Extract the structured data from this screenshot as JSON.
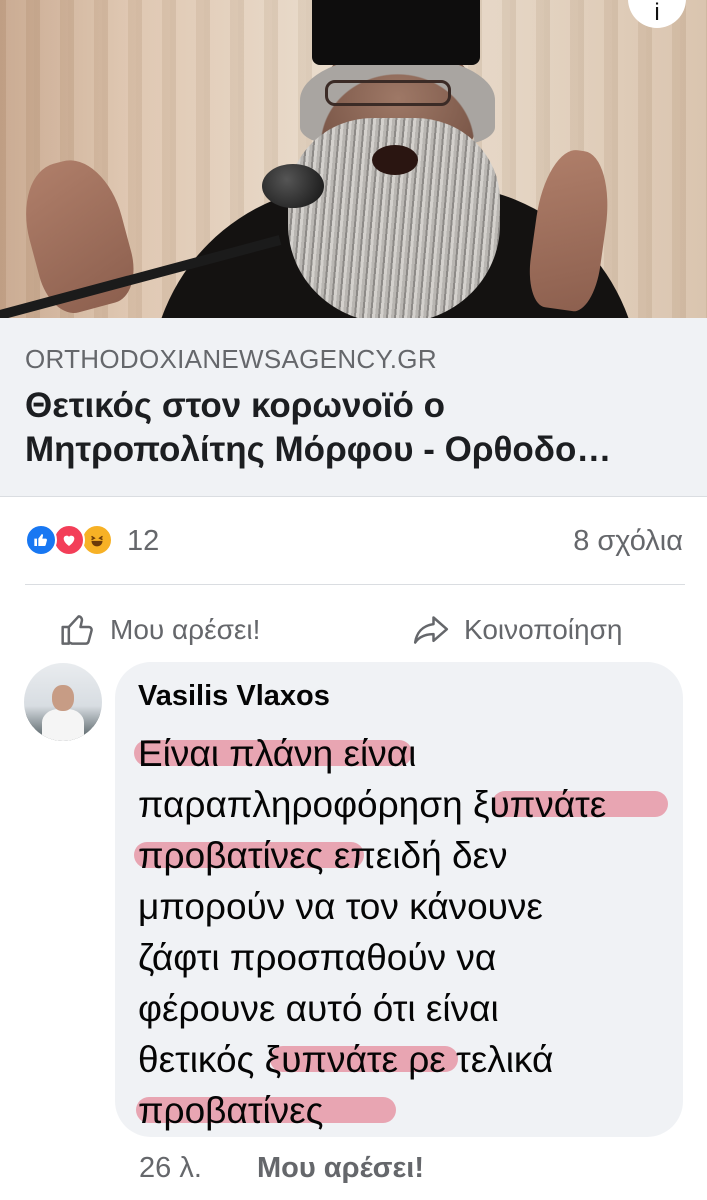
{
  "post": {
    "link_preview": {
      "domain": "ORTHODOXIANEWSAGENCY.GR",
      "title": "Θετικός στον κορωνοϊό ο\nΜητροπολίτης Μόρφου - Ορθοδο…"
    },
    "reactions": {
      "types": [
        "like-icon",
        "love-icon",
        "haha-icon"
      ],
      "count": "12",
      "comments_label": "8 σχόλια"
    },
    "actions": {
      "like_label": "Μου αρέσει!",
      "share_label": "Κοινοποίηση"
    }
  },
  "comment": {
    "author": "Vasilis Vlaxos",
    "text": "Είναι πλάνη  είναι\nπαραπληροφόρηση ξυπνάτε\nπροβατίνες επειδή δεν\nμπορούν να τον κάνουνε\nζάφτι προσπαθούν να\nφέρουνε αυτό ότι είναι\nθετικός ξυπνάτε ρε τελικά\nπροβατίνες",
    "time": "26 λ.",
    "like_label": "Μου αρέσει!",
    "highlight_color": "#e26c82"
  },
  "colors": {
    "link_card_bg": "#f0f2f5",
    "secondary_text": "#65676b",
    "like_blue": "#1877f2",
    "love_red": "#f33e58",
    "haha_yellow": "#f7b125"
  }
}
